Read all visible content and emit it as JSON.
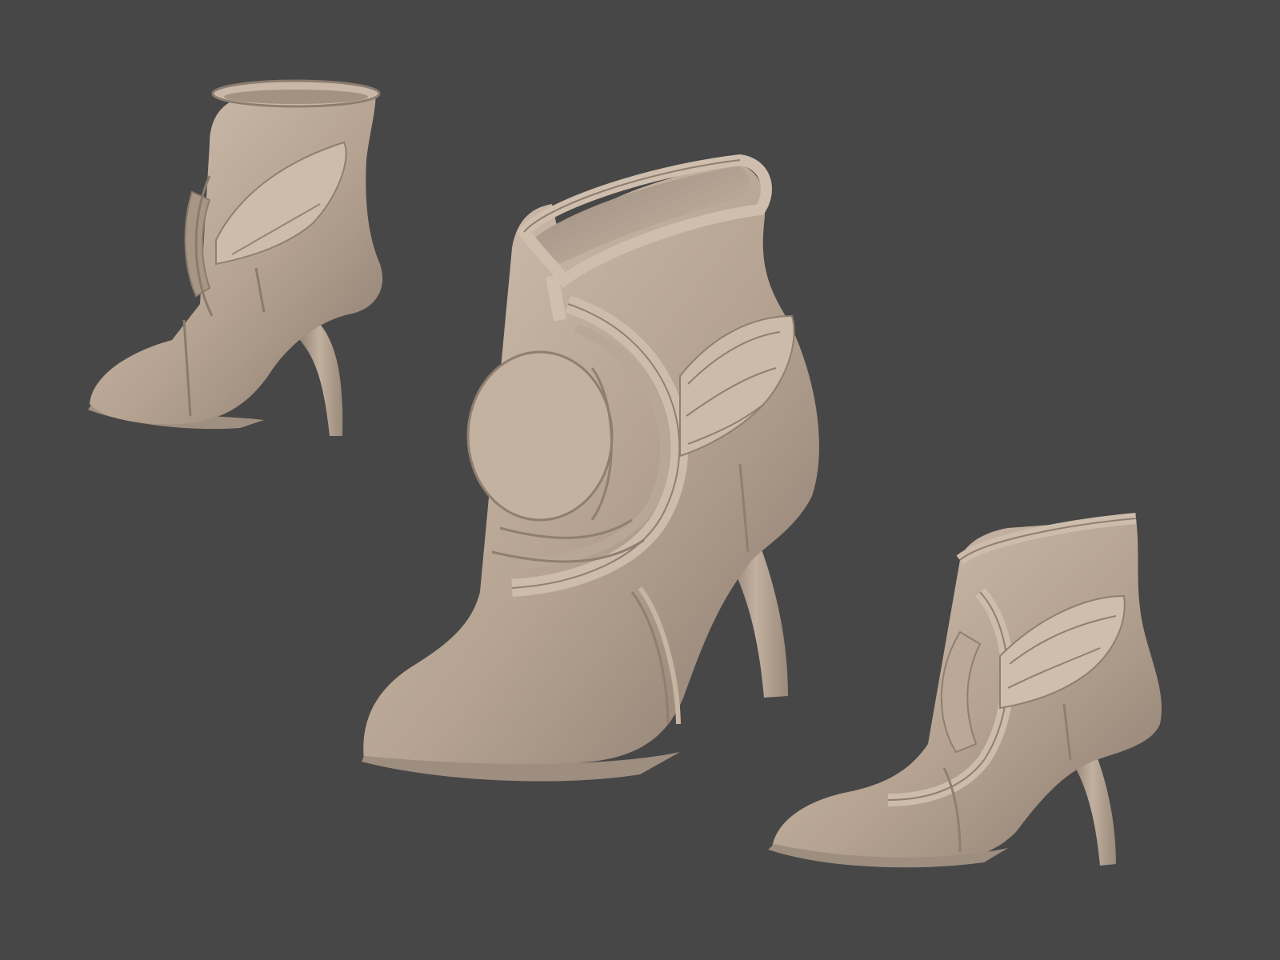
{
  "scene": {
    "background_color": "#474747",
    "clay_color": "#b7a493",
    "clay_shadow": "#85766a",
    "clay_highlight": "#d6c6b6",
    "models": [
      {
        "name": "boot-back-three-quarter-view",
        "view": "back-three-quarter"
      },
      {
        "name": "boot-side-view",
        "view": "side"
      },
      {
        "name": "boot-front-three-quarter-view",
        "view": "front-three-quarter"
      }
    ]
  }
}
